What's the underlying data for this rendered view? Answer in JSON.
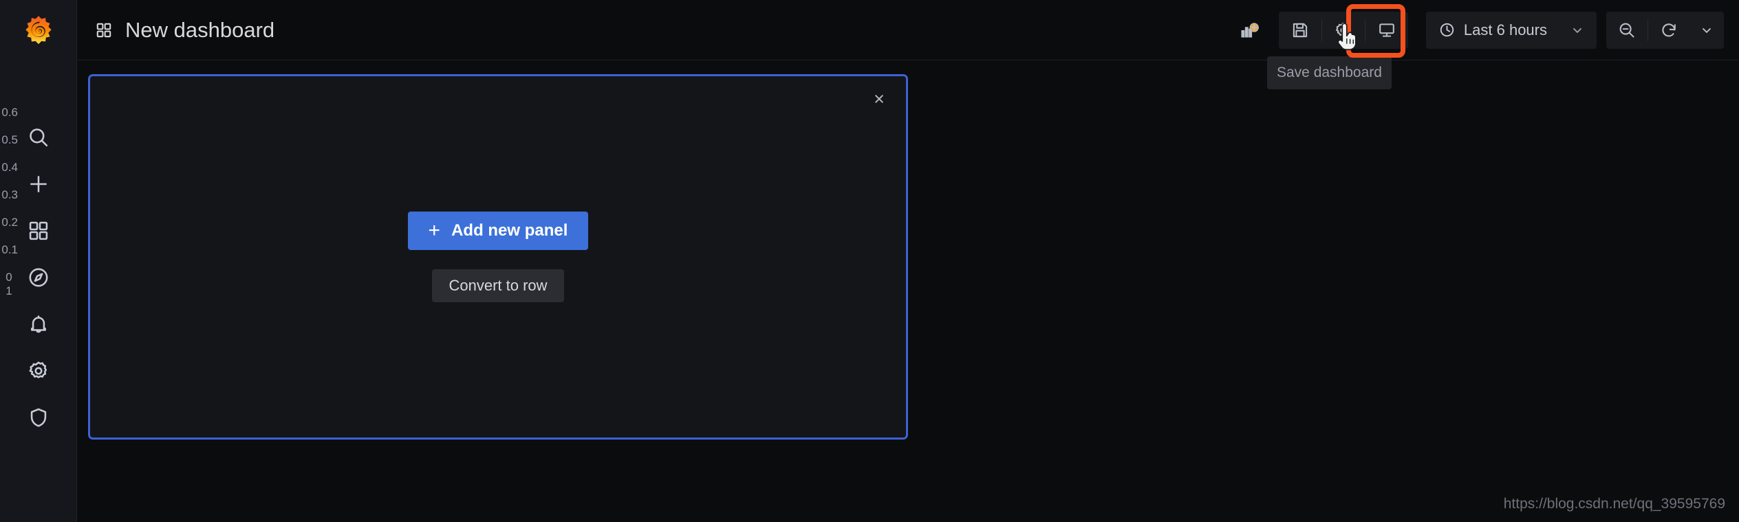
{
  "header": {
    "title": "New dashboard",
    "dashboard_icon": "dashboard-grid-icon",
    "brand_icon": "grafana-logo-icon"
  },
  "sidebar": {
    "items": [
      {
        "name": "search",
        "icon": "search-icon"
      },
      {
        "name": "create",
        "icon": "plus-icon"
      },
      {
        "name": "dashboards",
        "icon": "dashboards-grid-icon"
      },
      {
        "name": "explore",
        "icon": "compass-icon"
      },
      {
        "name": "alerting",
        "icon": "bell-icon"
      },
      {
        "name": "configuration",
        "icon": "gear-icon"
      },
      {
        "name": "server-admin",
        "icon": "shield-icon"
      }
    ]
  },
  "ghost_axis": {
    "ticks": [
      "0.6",
      "0.5",
      "0.4",
      "0.3",
      "0.2",
      "0.1",
      "0",
      "1"
    ]
  },
  "toolbar": {
    "add_panel": {
      "label": "Add panel",
      "icon": "add-panel-icon"
    },
    "save": {
      "label": "Save dashboard",
      "icon": "save-floppy-icon"
    },
    "settings": {
      "label": "Dashboard settings",
      "icon": "gear-icon"
    },
    "kiosk": {
      "label": "Cycle view mode",
      "icon": "tv-monitor-icon"
    },
    "zoom_out": {
      "label": "Zoom out time range",
      "icon": "zoom-out-icon"
    },
    "refresh": {
      "label": "Refresh dashboard",
      "icon": "refresh-icon"
    },
    "refresh_interval": {
      "label": "Refresh interval",
      "icon": "chevron-down-icon"
    }
  },
  "time_picker": {
    "value": "Last 6 hours",
    "icon": "clock-icon",
    "chevron": "chevron-down-icon"
  },
  "tooltip": {
    "text": "Save dashboard"
  },
  "panel": {
    "close_label": "×",
    "add_new_panel": "Add new panel",
    "add_new_panel_plus": "+",
    "convert_to_row": "Convert to row"
  },
  "watermark": {
    "text": "https://blog.csdn.net/qq_39595769"
  },
  "colors": {
    "accent_blue": "#3d71d9",
    "panel_border": "#3d62d6",
    "annotation_orange": "#f4511e",
    "canvas_bg": "#0b0c0e",
    "sidebar_bg": "#16171c",
    "panel_bg": "#141519"
  }
}
